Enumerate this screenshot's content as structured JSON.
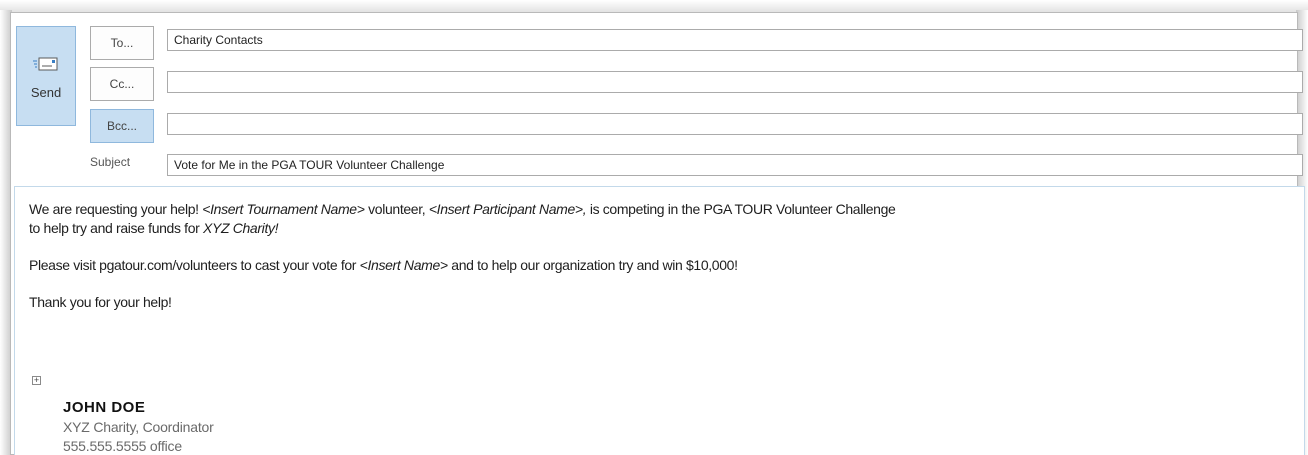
{
  "header": {
    "send_label": "Send",
    "to_label": "To...",
    "cc_label": "Cc...",
    "bcc_label": "Bcc...",
    "subject_label": "Subject",
    "to_value": "Charity Contacts",
    "cc_value": "",
    "bcc_value": "",
    "subject_value": "Vote for Me in the PGA TOUR Volunteer Challenge"
  },
  "body": {
    "p1_a": "We are requesting your help!  ",
    "p1_b": "<Insert Tournament Name>",
    "p1_c": "  volunteer, ",
    "p1_d": "<Insert Participant Name>,",
    "p1_e": " is competing in the PGA TOUR Volunteer Challenge",
    "p1_f": "to help try and raise funds for ",
    "p1_g": "XYZ Charity!",
    "p2_a": "Please visit pgatour.com/volunteers to cast your vote for ",
    "p2_b": "<Insert Name>",
    "p2_c": " and to help our organization try and win $10,000!",
    "p3": "Thank you for your help!"
  },
  "signature": {
    "name": "JOHN DOE",
    "title": "XYZ Charity, Coordinator",
    "phone": "555.555.5555 office"
  },
  "colors": {
    "accent": "#c7def2",
    "accent_border": "#8fb8dd"
  }
}
